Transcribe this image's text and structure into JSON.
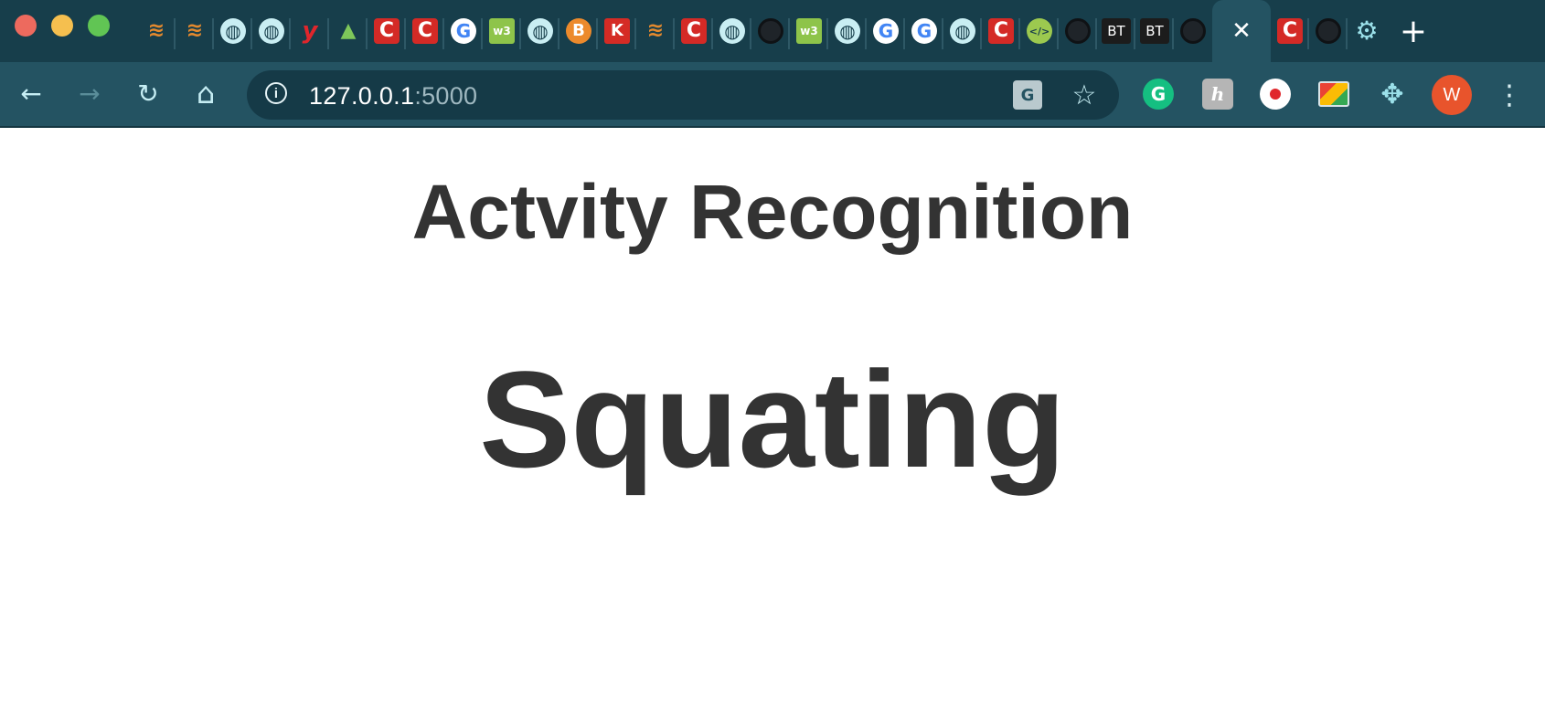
{
  "browser": {
    "tabs": [
      {
        "icon": "stackoverflow-icon",
        "glyph": "≋",
        "style": "so"
      },
      {
        "icon": "stackoverflow-icon",
        "glyph": "≋",
        "style": "so"
      },
      {
        "icon": "globe-icon",
        "glyph": "◍",
        "style": "globe"
      },
      {
        "icon": "globe-icon",
        "glyph": "◍",
        "style": "globe"
      },
      {
        "icon": "ycombinator-icon",
        "glyph": "y",
        "style": "yc"
      },
      {
        "icon": "android-icon",
        "glyph": "▲",
        "style": "android"
      },
      {
        "icon": "codecademy-icon",
        "glyph": "C",
        "style": "cred"
      },
      {
        "icon": "codecademy-icon",
        "glyph": "C",
        "style": "cred"
      },
      {
        "icon": "google-icon",
        "glyph": "G",
        "style": "g"
      },
      {
        "icon": "w3schools-icon",
        "glyph": "w3",
        "style": "w3"
      },
      {
        "icon": "globe-icon",
        "glyph": "◍",
        "style": "globe"
      },
      {
        "icon": "bitcoin-icon",
        "glyph": "B",
        "style": "btc"
      },
      {
        "icon": "k-icon",
        "glyph": "K",
        "style": "k"
      },
      {
        "icon": "stackoverflow-icon",
        "glyph": "≋",
        "style": "so"
      },
      {
        "icon": "codecademy-icon",
        "glyph": "C",
        "style": "cred"
      },
      {
        "icon": "globe-icon",
        "glyph": "◍",
        "style": "globe"
      },
      {
        "icon": "github-icon",
        "glyph": "",
        "style": "gh"
      },
      {
        "icon": "w3schools-icon",
        "glyph": "w3",
        "style": "w3"
      },
      {
        "icon": "globe-icon",
        "glyph": "◍",
        "style": "globe"
      },
      {
        "icon": "google-icon",
        "glyph": "G",
        "style": "g"
      },
      {
        "icon": "google-icon",
        "glyph": "G",
        "style": "g"
      },
      {
        "icon": "globe-icon",
        "glyph": "◍",
        "style": "globe"
      },
      {
        "icon": "codecademy-icon",
        "glyph": "C",
        "style": "cred"
      },
      {
        "icon": "code-icon",
        "glyph": "</>",
        "style": "code"
      },
      {
        "icon": "github-icon",
        "glyph": "",
        "style": "gh"
      },
      {
        "icon": "bt-icon",
        "glyph": "BT",
        "style": "bt"
      },
      {
        "icon": "bt-icon",
        "glyph": "BT",
        "style": "bt"
      },
      {
        "icon": "github-icon",
        "glyph": "",
        "style": "gh"
      }
    ],
    "active_tab": {
      "close_glyph": "✕"
    },
    "tabs_after": [
      {
        "icon": "codecademy-icon",
        "glyph": "C",
        "style": "cred"
      },
      {
        "icon": "github-icon",
        "glyph": "",
        "style": "gh"
      },
      {
        "icon": "settings-gear-icon",
        "glyph": "⚙",
        "style": "gear"
      }
    ],
    "new_tab_glyph": "+",
    "toolbar": {
      "back_glyph": "←",
      "forward_glyph": "→",
      "reload_glyph": "↻",
      "home_glyph": "⌂",
      "info_glyph": "i",
      "url_host": "127.0.0.1",
      "url_port": ":5000",
      "translate_glyph": "G",
      "star_glyph": "☆",
      "grammarly_glyph": "G",
      "honey_glyph": "h",
      "puzzle_glyph": "✥",
      "avatar_letter": "W",
      "menu_glyph": "⋮"
    }
  },
  "page": {
    "title": "Actvity Recognition",
    "activity": "Squating"
  },
  "colors": {
    "tabstrip_bg": "#173e4b",
    "toolbar_bg": "#245362",
    "omnibox_bg": "#153a47",
    "text_dark": "#333333",
    "avatar_bg": "#e8542c"
  }
}
